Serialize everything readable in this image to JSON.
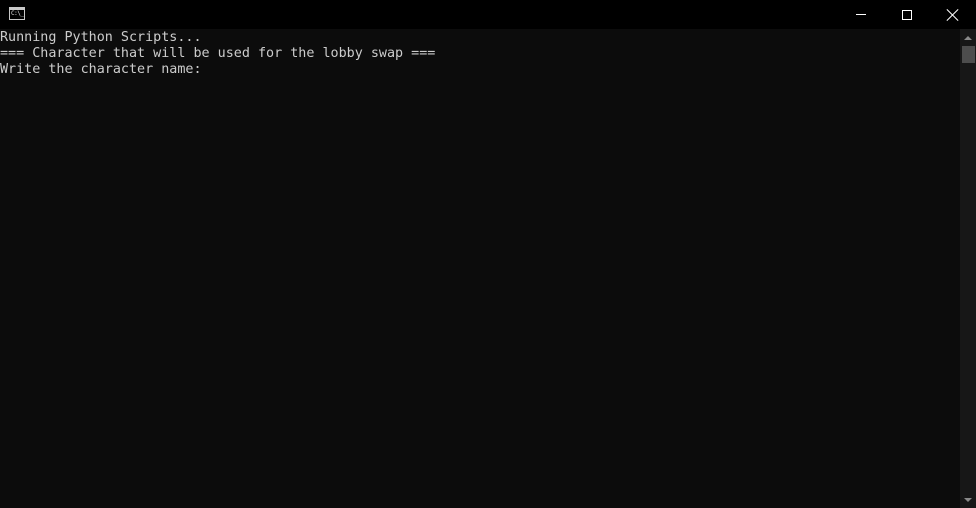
{
  "window": {
    "icon": "console-app-icon",
    "icon_text": "C:\\_",
    "controls": {
      "minimize_icon": "minimize-icon",
      "maximize_icon": "maximize-icon",
      "close_icon": "close-icon"
    }
  },
  "console": {
    "lines": [
      "Running Python Scripts...",
      "=== Character that will be used for the lobby swap ===",
      "Write the character name:"
    ],
    "text_color": "#cccccc",
    "background_color": "#0c0c0c"
  },
  "scrollbar": {
    "up_icon": "scroll-up-arrow-icon",
    "down_icon": "scroll-down-arrow-icon",
    "position": 0
  }
}
